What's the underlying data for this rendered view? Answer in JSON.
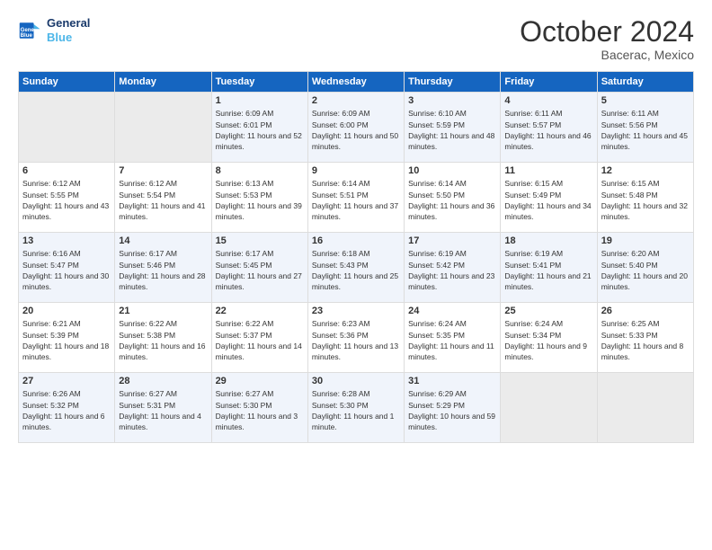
{
  "logo": {
    "line1": "General",
    "line2": "Blue"
  },
  "title": "October 2024",
  "location": "Bacerac, Mexico",
  "weekdays": [
    "Sunday",
    "Monday",
    "Tuesday",
    "Wednesday",
    "Thursday",
    "Friday",
    "Saturday"
  ],
  "weeks": [
    [
      {
        "day": "",
        "empty": true
      },
      {
        "day": "",
        "empty": true
      },
      {
        "day": "1",
        "sunrise": "6:09 AM",
        "sunset": "6:01 PM",
        "daylight": "11 hours and 52 minutes."
      },
      {
        "day": "2",
        "sunrise": "6:09 AM",
        "sunset": "6:00 PM",
        "daylight": "11 hours and 50 minutes."
      },
      {
        "day": "3",
        "sunrise": "6:10 AM",
        "sunset": "5:59 PM",
        "daylight": "11 hours and 48 minutes."
      },
      {
        "day": "4",
        "sunrise": "6:11 AM",
        "sunset": "5:57 PM",
        "daylight": "11 hours and 46 minutes."
      },
      {
        "day": "5",
        "sunrise": "6:11 AM",
        "sunset": "5:56 PM",
        "daylight": "11 hours and 45 minutes."
      }
    ],
    [
      {
        "day": "6",
        "sunrise": "6:12 AM",
        "sunset": "5:55 PM",
        "daylight": "11 hours and 43 minutes."
      },
      {
        "day": "7",
        "sunrise": "6:12 AM",
        "sunset": "5:54 PM",
        "daylight": "11 hours and 41 minutes."
      },
      {
        "day": "8",
        "sunrise": "6:13 AM",
        "sunset": "5:53 PM",
        "daylight": "11 hours and 39 minutes."
      },
      {
        "day": "9",
        "sunrise": "6:14 AM",
        "sunset": "5:51 PM",
        "daylight": "11 hours and 37 minutes."
      },
      {
        "day": "10",
        "sunrise": "6:14 AM",
        "sunset": "5:50 PM",
        "daylight": "11 hours and 36 minutes."
      },
      {
        "day": "11",
        "sunrise": "6:15 AM",
        "sunset": "5:49 PM",
        "daylight": "11 hours and 34 minutes."
      },
      {
        "day": "12",
        "sunrise": "6:15 AM",
        "sunset": "5:48 PM",
        "daylight": "11 hours and 32 minutes."
      }
    ],
    [
      {
        "day": "13",
        "sunrise": "6:16 AM",
        "sunset": "5:47 PM",
        "daylight": "11 hours and 30 minutes."
      },
      {
        "day": "14",
        "sunrise": "6:17 AM",
        "sunset": "5:46 PM",
        "daylight": "11 hours and 28 minutes."
      },
      {
        "day": "15",
        "sunrise": "6:17 AM",
        "sunset": "5:45 PM",
        "daylight": "11 hours and 27 minutes."
      },
      {
        "day": "16",
        "sunrise": "6:18 AM",
        "sunset": "5:43 PM",
        "daylight": "11 hours and 25 minutes."
      },
      {
        "day": "17",
        "sunrise": "6:19 AM",
        "sunset": "5:42 PM",
        "daylight": "11 hours and 23 minutes."
      },
      {
        "day": "18",
        "sunrise": "6:19 AM",
        "sunset": "5:41 PM",
        "daylight": "11 hours and 21 minutes."
      },
      {
        "day": "19",
        "sunrise": "6:20 AM",
        "sunset": "5:40 PM",
        "daylight": "11 hours and 20 minutes."
      }
    ],
    [
      {
        "day": "20",
        "sunrise": "6:21 AM",
        "sunset": "5:39 PM",
        "daylight": "11 hours and 18 minutes."
      },
      {
        "day": "21",
        "sunrise": "6:22 AM",
        "sunset": "5:38 PM",
        "daylight": "11 hours and 16 minutes."
      },
      {
        "day": "22",
        "sunrise": "6:22 AM",
        "sunset": "5:37 PM",
        "daylight": "11 hours and 14 minutes."
      },
      {
        "day": "23",
        "sunrise": "6:23 AM",
        "sunset": "5:36 PM",
        "daylight": "11 hours and 13 minutes."
      },
      {
        "day": "24",
        "sunrise": "6:24 AM",
        "sunset": "5:35 PM",
        "daylight": "11 hours and 11 minutes."
      },
      {
        "day": "25",
        "sunrise": "6:24 AM",
        "sunset": "5:34 PM",
        "daylight": "11 hours and 9 minutes."
      },
      {
        "day": "26",
        "sunrise": "6:25 AM",
        "sunset": "5:33 PM",
        "daylight": "11 hours and 8 minutes."
      }
    ],
    [
      {
        "day": "27",
        "sunrise": "6:26 AM",
        "sunset": "5:32 PM",
        "daylight": "11 hours and 6 minutes."
      },
      {
        "day": "28",
        "sunrise": "6:27 AM",
        "sunset": "5:31 PM",
        "daylight": "11 hours and 4 minutes."
      },
      {
        "day": "29",
        "sunrise": "6:27 AM",
        "sunset": "5:30 PM",
        "daylight": "11 hours and 3 minutes."
      },
      {
        "day": "30",
        "sunrise": "6:28 AM",
        "sunset": "5:30 PM",
        "daylight": "11 hours and 1 minute."
      },
      {
        "day": "31",
        "sunrise": "6:29 AM",
        "sunset": "5:29 PM",
        "daylight": "10 hours and 59 minutes."
      },
      {
        "day": "",
        "empty": true
      },
      {
        "day": "",
        "empty": true
      }
    ]
  ]
}
